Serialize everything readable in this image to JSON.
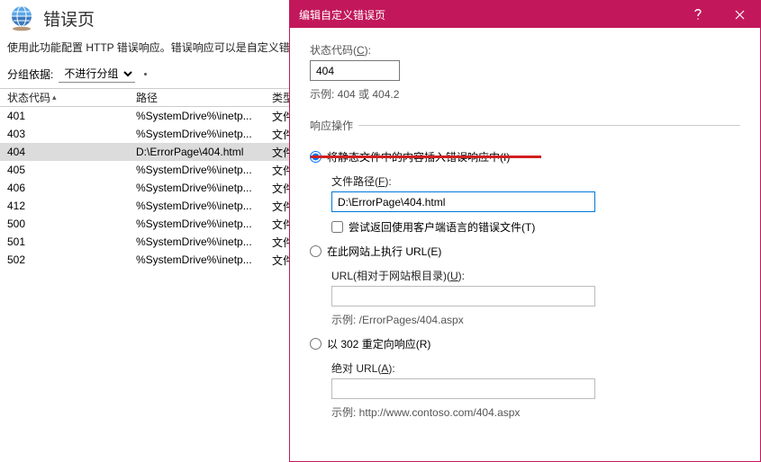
{
  "page": {
    "title": "错误页",
    "description": "使用此功能配置 HTTP 错误响应。错误响应可以是自定义错误"
  },
  "group": {
    "label": "分组依据:",
    "selected": "不进行分组"
  },
  "grid": {
    "columns": {
      "code": "状态代码",
      "path": "路径",
      "type": "类型"
    },
    "rows": [
      {
        "code": "401",
        "path": "%SystemDrive%\\inetp...",
        "type": "文件",
        "selected": false
      },
      {
        "code": "403",
        "path": "%SystemDrive%\\inetp...",
        "type": "文件",
        "selected": false
      },
      {
        "code": "404",
        "path": "D:\\ErrorPage\\404.html",
        "type": "文件",
        "selected": true
      },
      {
        "code": "405",
        "path": "%SystemDrive%\\inetp...",
        "type": "文件",
        "selected": false
      },
      {
        "code": "406",
        "path": "%SystemDrive%\\inetp...",
        "type": "文件",
        "selected": false
      },
      {
        "code": "412",
        "path": "%SystemDrive%\\inetp...",
        "type": "文件",
        "selected": false
      },
      {
        "code": "500",
        "path": "%SystemDrive%\\inetp...",
        "type": "文件",
        "selected": false
      },
      {
        "code": "501",
        "path": "%SystemDrive%\\inetp...",
        "type": "文件",
        "selected": false
      },
      {
        "code": "502",
        "path": "%SystemDrive%\\inetp...",
        "type": "文件",
        "selected": false
      }
    ]
  },
  "dialog": {
    "title": "编辑自定义错误页",
    "status_code": {
      "label_pre": "状态代码(",
      "accel": "C",
      "label_post": "):",
      "value": "404",
      "example": "示例: 404 或 404.2"
    },
    "response": {
      "legend": "响应操作",
      "opt_static": {
        "pre": "将静态文件中的内容插入错误响应中(",
        "accel": "I",
        "post": ")"
      },
      "file_path": {
        "label_pre": "文件路径(",
        "accel": "F",
        "post": "):",
        "value": "D:\\ErrorPage\\404.html"
      },
      "client_lang": {
        "pre": "尝试返回使用客户端语言的错误文件(",
        "accel": "T",
        "post": ")"
      },
      "opt_exec": {
        "pre": "在此网站上执行 URL(",
        "accel": "E",
        "post": ")"
      },
      "url_rel": {
        "label_pre": "URL(相对于网站根目录)(",
        "accel": "U",
        "post": "):",
        "example": "示例: /ErrorPages/404.aspx"
      },
      "opt_302": {
        "pre": "以 302 重定向响应(",
        "accel": "R",
        "post": ")"
      },
      "abs_url": {
        "label_pre": "绝对 URL(",
        "accel": "A",
        "post": "):",
        "example": "示例: http://www.contoso.com/404.aspx"
      }
    }
  }
}
